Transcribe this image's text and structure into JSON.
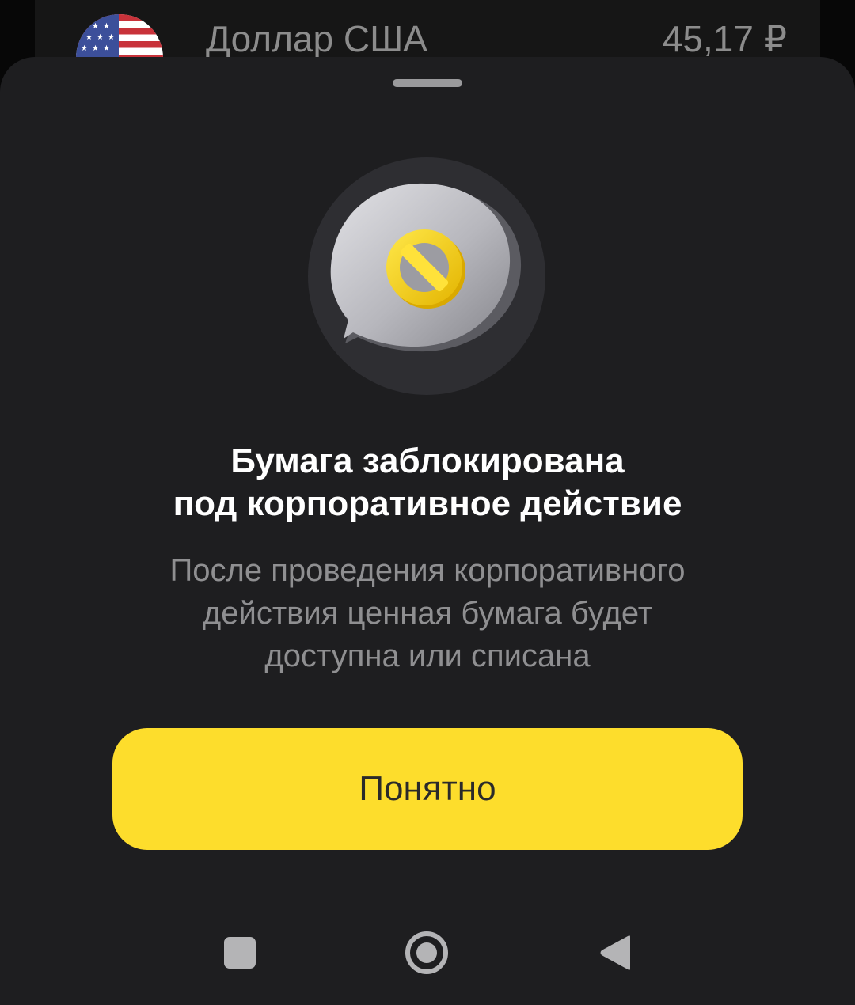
{
  "background_row": {
    "flag_icon": "us-flag-icon",
    "currency_name": "Доллар США",
    "price": "45,17 ₽"
  },
  "sheet": {
    "illustration_icon": "blocked-message-icon",
    "title_lines": [
      "Бумага заблокирована",
      "под корпоративное действие"
    ],
    "description_lines": [
      "После проведения корпоративного",
      "действия ценная бумага будет",
      "доступна или списана"
    ],
    "button_label": "Понятно"
  },
  "nav_bar": {
    "recents_icon": "square-recents-icon",
    "home_icon": "circle-home-icon",
    "back_icon": "triangle-back-icon"
  },
  "colors": {
    "sheet_bg": "#1e1e20",
    "accent_yellow": "#fddd2c",
    "title_text": "#ffffff",
    "secondary_text": "#8f8f91"
  }
}
